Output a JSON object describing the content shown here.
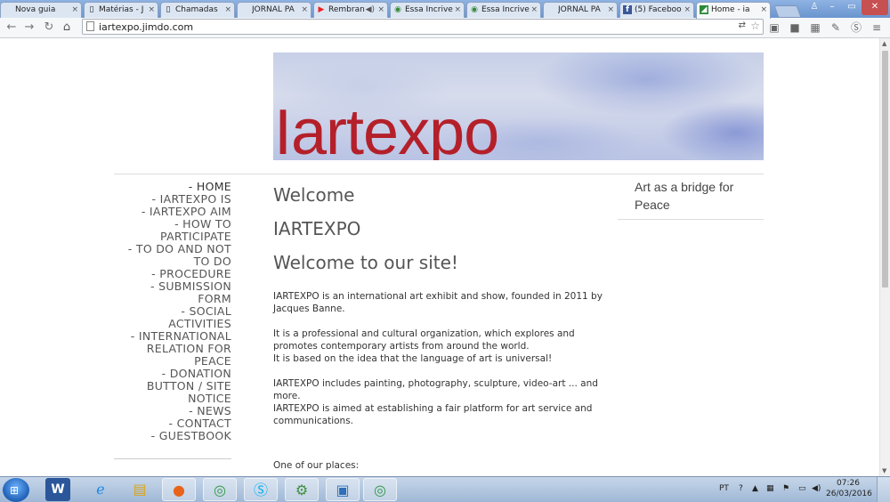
{
  "browser": {
    "tabs": [
      {
        "label": "Nova guia",
        "icon": "blank-tab-icon"
      },
      {
        "label": "Matérias - J",
        "icon": "document-icon"
      },
      {
        "label": "Chamadas",
        "icon": "document-icon"
      },
      {
        "label": "JORNAL PA",
        "icon": "blank-tab-icon"
      },
      {
        "label": "Rembran",
        "icon": "youtube-icon"
      },
      {
        "label": "Essa Incrive",
        "icon": "globe-icon"
      },
      {
        "label": "Essa Incrive",
        "icon": "globe-icon"
      },
      {
        "label": "JORNAL PA",
        "icon": "blank-tab-icon"
      },
      {
        "label": "(5) Faceboo",
        "icon": "facebook-icon"
      },
      {
        "label": "Home - ia",
        "icon": "jimdo-icon"
      }
    ],
    "url": "iartexpo.jimdo.com"
  },
  "site": {
    "banner_title": "Iartexpo",
    "nav": [
      "- HOME",
      "- IARTEXPO IS",
      "- IARTEXPO AIM",
      "- HOW TO PARTICIPATE",
      "- TO DO AND NOT TO DO",
      "- PROCEDURE",
      "- SUBMISSION FORM",
      "- SOCIAL ACTIVITIES",
      "- INTERNATIONAL RELATION FOR PEACE",
      "- DONATION BUTTON / SITE NOTICE",
      "- NEWS",
      "- CONTACT",
      "- GUESTBOOK"
    ],
    "main": {
      "heading1": "Welcome",
      "heading2": "IARTEXPO",
      "heading3": "Welcome to our site!",
      "para1": "IARTEXPO is an international art exhibit and show, founded in 2011 by Jacques Banne.",
      "para2a": "It is a professional and cultural organization, which explores and promotes contemporary artists from around the world.",
      "para2b": "It is based on the idea that the language of art is universal!",
      "para3a": "IARTEXPO includes painting, photography, sculpture, video-art ... and more.",
      "para3b": "IARTEXPO is aimed at establishing a fair platform for art service and communications.",
      "para4": "One of our places:"
    },
    "sidebar_text": "Art as a bridge for Peace"
  },
  "taskbar": {
    "apps": [
      "word-icon",
      "internet-explorer-icon",
      "file-explorer-icon",
      "firefox-icon",
      "chrome-icon",
      "skype-icon",
      "network-icon",
      "screenshot-tool-icon",
      "chrome-icon"
    ],
    "language": "PT",
    "time": "07:26",
    "date": "26/03/2016"
  }
}
